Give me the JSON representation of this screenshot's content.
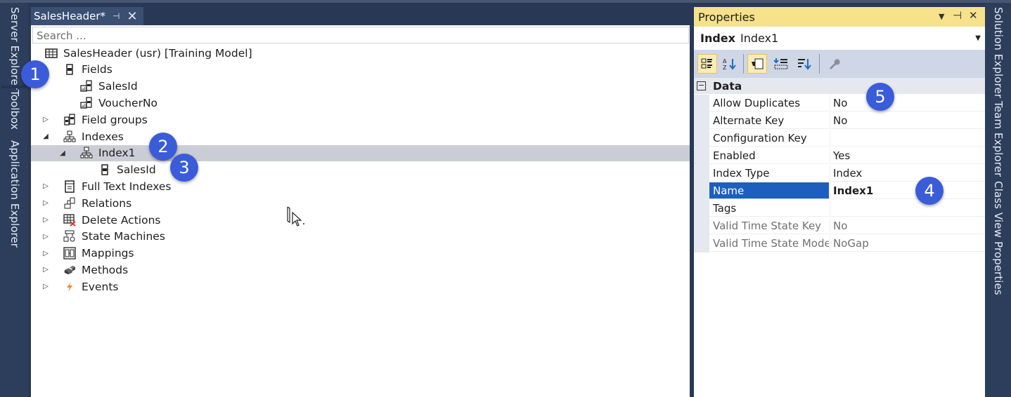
{
  "left_rail": {
    "tabs": [
      {
        "label": "Server Explorer"
      },
      {
        "label": "Toolbox"
      },
      {
        "label": "Application Explorer"
      }
    ]
  },
  "editor": {
    "tab": {
      "title": "SalesHeader*",
      "pin_icon": "pin-icon",
      "close_icon": "close-icon"
    },
    "search": {
      "placeholder": "Search ..."
    },
    "tree": [
      {
        "label": "SalesHeader (usr) [Training Model]",
        "icon": "table-icon",
        "level": 0,
        "expander": "none"
      },
      {
        "label": "Fields",
        "icon": "fields-icon",
        "level": 1,
        "expander": "none"
      },
      {
        "label": "SalesId",
        "icon": "field-string-icon",
        "level": 2,
        "expander": "none"
      },
      {
        "label": "VoucherNo",
        "icon": "field-string-icon",
        "level": 2,
        "expander": "none"
      },
      {
        "label": "Field groups",
        "icon": "field-groups-icon",
        "level": 1,
        "expander": "collapsed"
      },
      {
        "label": "Indexes",
        "icon": "indexes-icon",
        "level": 1,
        "expander": "expanded"
      },
      {
        "label": "Index1",
        "icon": "index-icon",
        "level": 2,
        "expander": "expanded",
        "selected": true
      },
      {
        "label": "SalesId",
        "icon": "index-field-icon",
        "level": 3,
        "expander": "none"
      },
      {
        "label": "Full Text Indexes",
        "icon": "full-text-index-icon",
        "level": 1,
        "expander": "collapsed"
      },
      {
        "label": "Relations",
        "icon": "relations-icon",
        "level": 1,
        "expander": "collapsed"
      },
      {
        "label": "Delete Actions",
        "icon": "delete-actions-icon",
        "level": 1,
        "expander": "collapsed"
      },
      {
        "label": "State Machines",
        "icon": "state-machines-icon",
        "level": 1,
        "expander": "collapsed"
      },
      {
        "label": "Mappings",
        "icon": "mappings-icon",
        "level": 1,
        "expander": "collapsed"
      },
      {
        "label": "Methods",
        "icon": "methods-icon",
        "level": 1,
        "expander": "collapsed"
      },
      {
        "label": "Events",
        "icon": "events-icon",
        "level": 1,
        "expander": "collapsed"
      }
    ]
  },
  "properties": {
    "title": "Properties",
    "object_kind": "Index",
    "object_name": "Index1",
    "toolbar": [
      {
        "name": "categorized-icon",
        "active": true
      },
      {
        "name": "alphabetical-icon",
        "active": false
      },
      {
        "name": "properties-page-icon",
        "active": true
      },
      {
        "name": "events-list-icon",
        "active": false
      },
      {
        "name": "sort-icon",
        "active": false
      },
      {
        "name": "wrench-icon",
        "active": false
      }
    ],
    "category": "Data",
    "rows": [
      {
        "name": "Allow Duplicates",
        "value": "No"
      },
      {
        "name": "Alternate Key",
        "value": "No"
      },
      {
        "name": "Configuration Key",
        "value": ""
      },
      {
        "name": "Enabled",
        "value": "Yes"
      },
      {
        "name": "Index Type",
        "value": "Index"
      },
      {
        "name": "Name",
        "value": "Index1",
        "selected": true
      },
      {
        "name": "Tags",
        "value": ""
      },
      {
        "name": "Valid Time State Key",
        "value": "No",
        "disabled": true
      },
      {
        "name": "Valid Time State Mode",
        "value": "NoGap",
        "disabled": true
      }
    ]
  },
  "right_rail": {
    "tabs": [
      {
        "label": "Solution Explorer"
      },
      {
        "label": "Team Explorer"
      },
      {
        "label": "Class View"
      },
      {
        "label": "Properties"
      }
    ]
  },
  "annotations": [
    "1",
    "2",
    "3",
    "4",
    "5"
  ],
  "colors": {
    "chrome": "#293955",
    "properties_title": "#f5e28a",
    "selection": "#1c5fbf",
    "badge": "#3b5cd9"
  }
}
